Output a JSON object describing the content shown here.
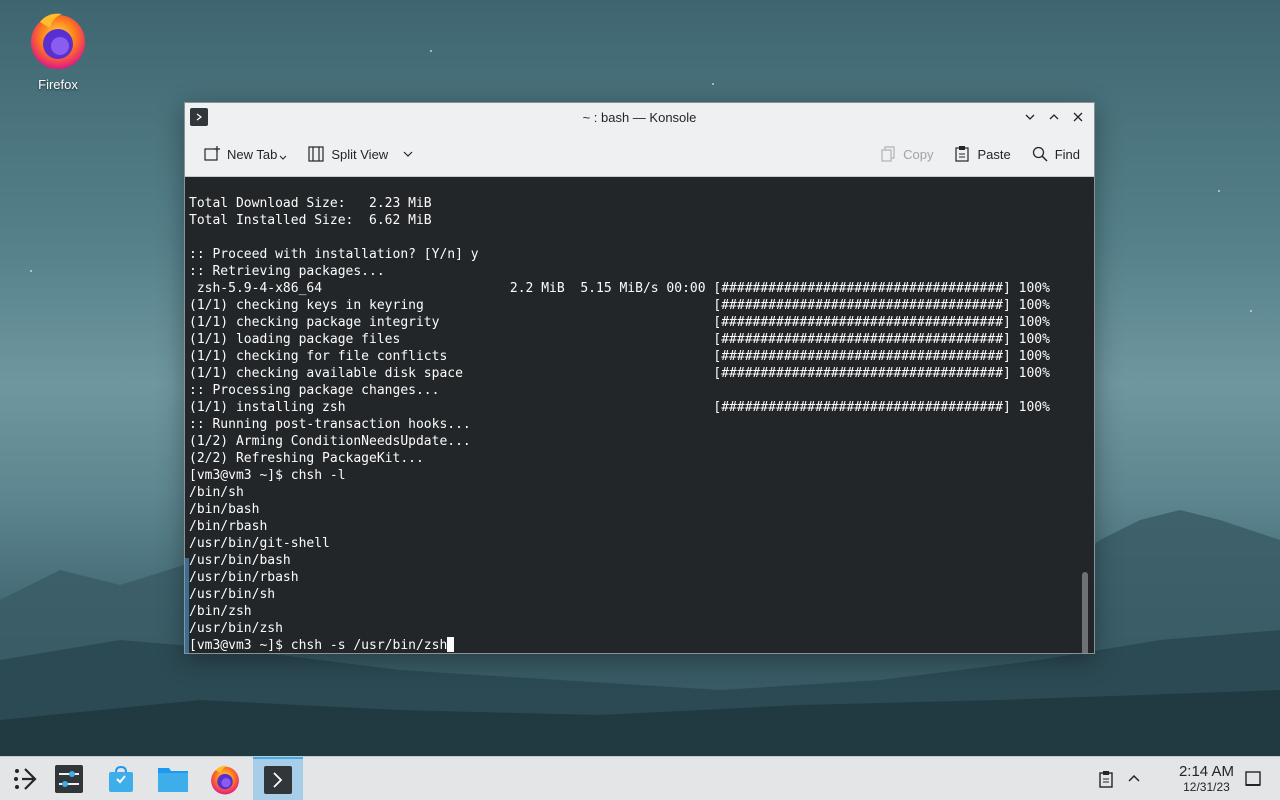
{
  "desktop": {
    "icons": [
      {
        "label": "Firefox",
        "icon": "firefox-icon"
      }
    ]
  },
  "window": {
    "title": "~ : bash — Konsole",
    "toolbar": {
      "new_tab": "New Tab",
      "split_view": "Split View",
      "copy": "Copy",
      "paste": "Paste",
      "find": "Find"
    },
    "terminal_lines": [
      "Total Download Size:   2.23 MiB",
      "Total Installed Size:  6.62 MiB",
      "",
      ":: Proceed with installation? [Y/n] y",
      ":: Retrieving packages...",
      " zsh-5.9-4-x86_64                        2.2 MiB  5.15 MiB/s 00:00 [####################################] 100%",
      "(1/1) checking keys in keyring                                     [####################################] 100%",
      "(1/1) checking package integrity                                   [####################################] 100%",
      "(1/1) loading package files                                        [####################################] 100%",
      "(1/1) checking for file conflicts                                  [####################################] 100%",
      "(1/1) checking available disk space                                [####################################] 100%",
      ":: Processing package changes...",
      "(1/1) installing zsh                                               [####################################] 100%",
      ":: Running post-transaction hooks...",
      "(1/2) Arming ConditionNeedsUpdate...",
      "(2/2) Refreshing PackageKit...",
      "[vm3@vm3 ~]$ chsh -l",
      "/bin/sh",
      "/bin/bash",
      "/bin/rbash",
      "/usr/bin/git-shell",
      "/usr/bin/bash",
      "/usr/bin/rbash",
      "/usr/bin/sh",
      "/bin/zsh",
      "/usr/bin/zsh"
    ],
    "prompt_line": "[vm3@vm3 ~]$ chsh -s /usr/bin/zsh"
  },
  "taskbar": {
    "items": [
      {
        "name": "application-launcher",
        "icon": "launcher-icon"
      },
      {
        "name": "system-settings",
        "icon": "settings-icon"
      },
      {
        "name": "discover",
        "icon": "store-icon"
      },
      {
        "name": "dolphin",
        "icon": "folder-icon"
      },
      {
        "name": "firefox",
        "icon": "firefox-icon"
      },
      {
        "name": "konsole",
        "icon": "terminal-icon",
        "active": true
      }
    ],
    "clock": {
      "time": "2:14 AM",
      "date": "12/31/23"
    }
  },
  "colors": {
    "terminal_bg": "#232629",
    "terminal_fg": "#fcfcfc",
    "chrome_bg": "#eff0f1",
    "active_task": "#a8cde9",
    "accent": "#3daee9"
  }
}
